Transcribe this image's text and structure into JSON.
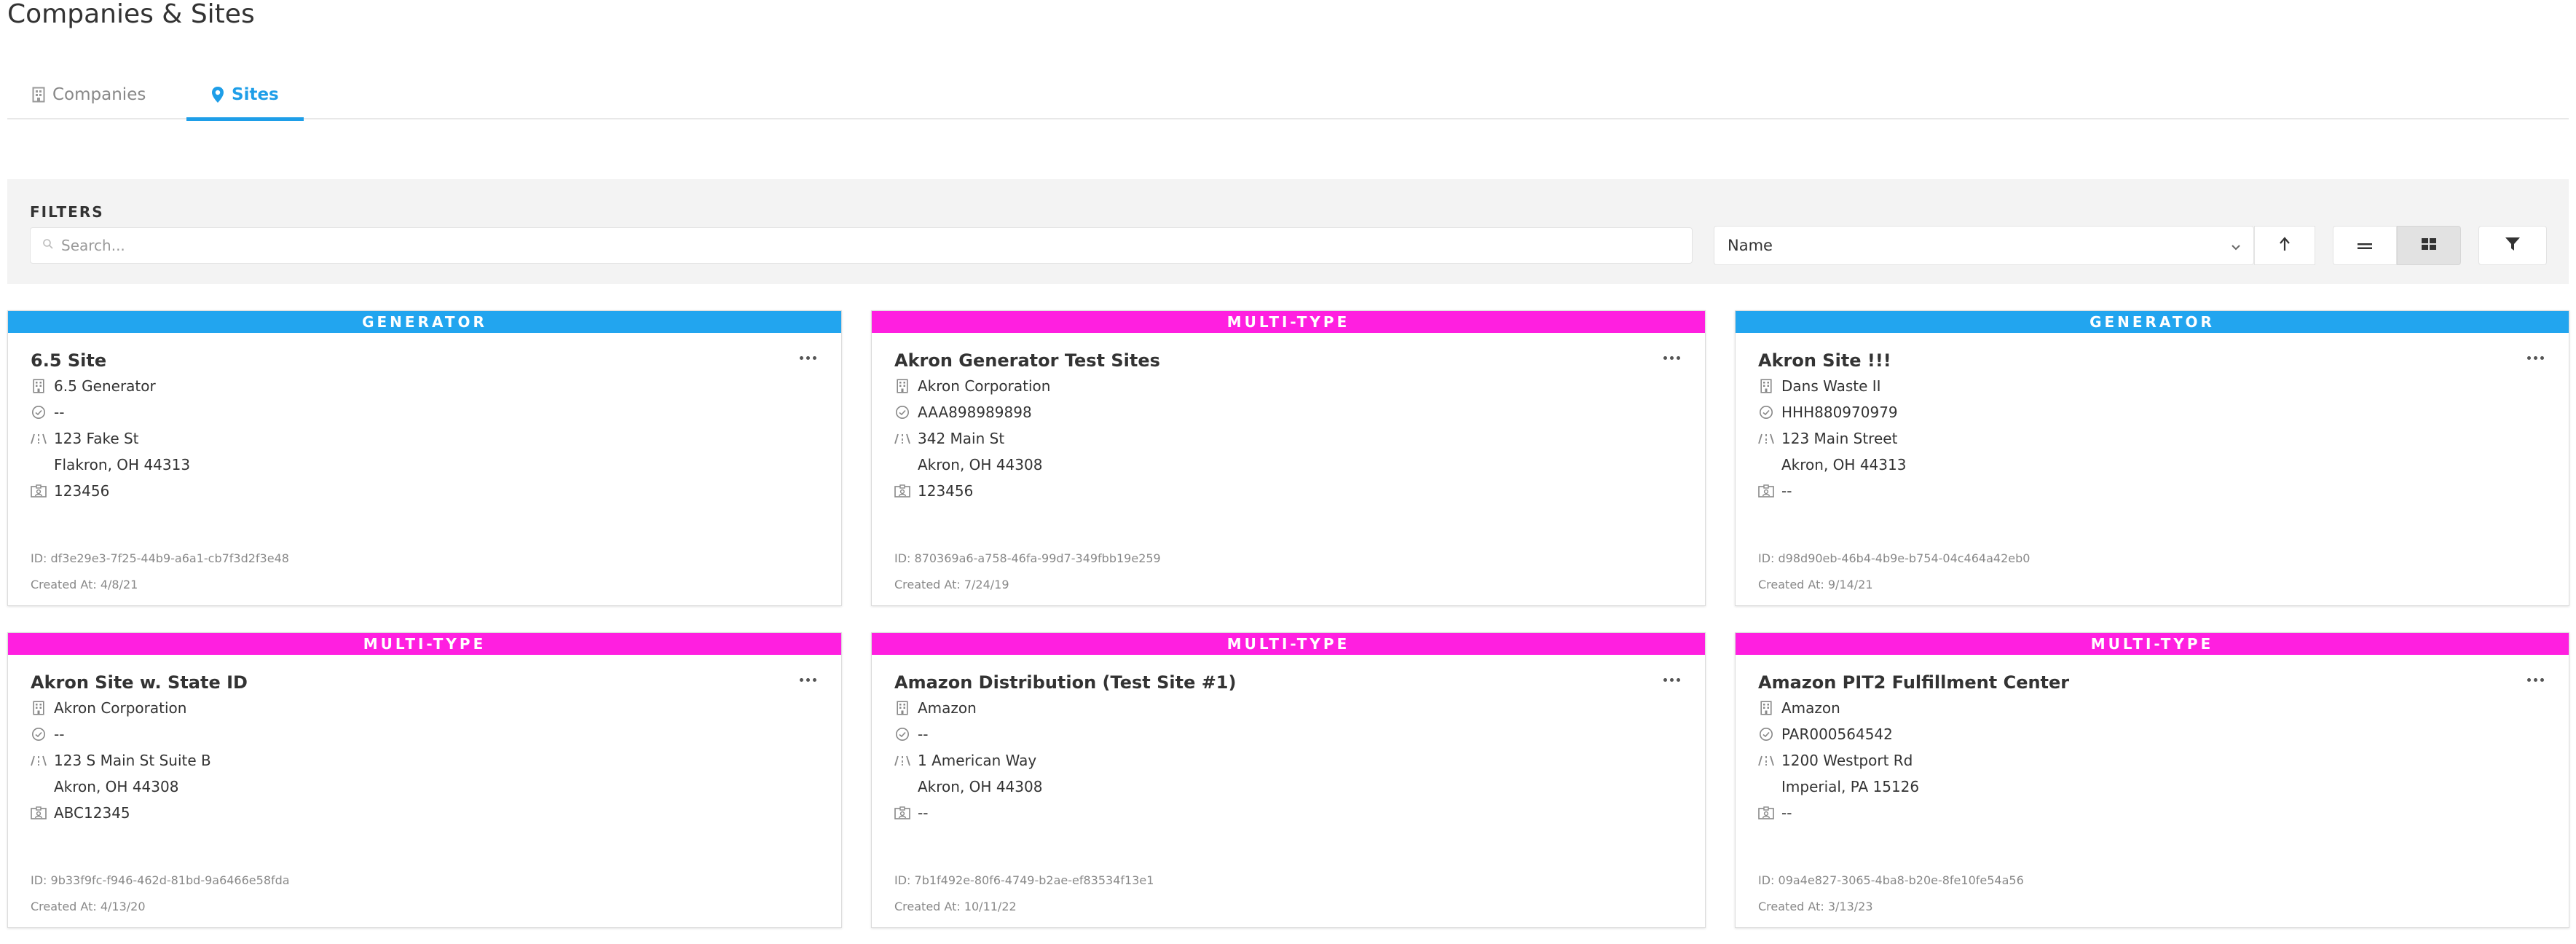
{
  "page": {
    "title": "Companies & Sites"
  },
  "tabs": [
    {
      "label": "Companies",
      "icon": "building-icon",
      "active": false
    },
    {
      "label": "Sites",
      "icon": "map-pin-icon",
      "active": true
    }
  ],
  "filters": {
    "label": "FILTERS",
    "search_placeholder": "Search...",
    "sort_value": "Name",
    "sort_direction": "ascending",
    "view_mode": "grid"
  },
  "colors": {
    "accent": "#1e9ee8",
    "generator": "#22a5ef",
    "multi_type": "#ff1fe0"
  },
  "cards": [
    {
      "type": "GENERATOR",
      "color": "#22a5ef",
      "title": "6.5 Site",
      "company": "6.5 Generator",
      "epa_id": "--",
      "street": "123 Fake St",
      "city": "Flakron, OH 44313",
      "site_code": "123456",
      "id": "ID: df3e29e3-7f25-44b9-a6a1-cb7f3d2f3e48",
      "created": "Created At: 4/8/21"
    },
    {
      "type": "MULTI-TYPE",
      "color": "#ff1fe0",
      "title": "Akron Generator Test Sites",
      "company": "Akron Corporation",
      "epa_id": "AAA898989898",
      "street": "342 Main St",
      "city": "Akron, OH 44308",
      "site_code": "123456",
      "id": "ID: 870369a6-a758-46fa-99d7-349fbb19e259",
      "created": "Created At: 7/24/19"
    },
    {
      "type": "GENERATOR",
      "color": "#22a5ef",
      "title": "Akron Site !!!",
      "company": "Dans Waste II",
      "epa_id": "HHH880970979",
      "street": "123 Main Street",
      "city": "Akron, OH 44313",
      "site_code": "--",
      "id": "ID: d98d90eb-46b4-4b9e-b754-04c464a42eb0",
      "created": "Created At: 9/14/21"
    },
    {
      "type": "MULTI-TYPE",
      "color": "#ff1fe0",
      "title": "Akron Site w. State ID",
      "company": "Akron Corporation",
      "epa_id": "--",
      "street": "123 S Main St Suite B",
      "city": "Akron, OH 44308",
      "site_code": "ABC12345",
      "id": "ID: 9b33f9fc-f946-462d-81bd-9a6466e58fda",
      "created": "Created At: 4/13/20"
    },
    {
      "type": "MULTI-TYPE",
      "color": "#ff1fe0",
      "title": "Amazon Distribution (Test Site #1)",
      "company": "Amazon",
      "epa_id": "--",
      "street": "1 American Way",
      "city": "Akron, OH 44308",
      "site_code": "--",
      "id": "ID: 7b1f492e-80f6-4749-b2ae-ef83534f13e1",
      "created": "Created At: 10/11/22"
    },
    {
      "type": "MULTI-TYPE",
      "color": "#ff1fe0",
      "title": "Amazon PIT2 Fulfillment Center",
      "company": "Amazon",
      "epa_id": "PAR000564542",
      "street": "1200 Westport Rd",
      "city": "Imperial, PA 15126",
      "site_code": "--",
      "id": "ID: 09a4e827-3065-4ba8-b20e-8fe10fe54a56",
      "created": "Created At: 3/13/23"
    }
  ]
}
